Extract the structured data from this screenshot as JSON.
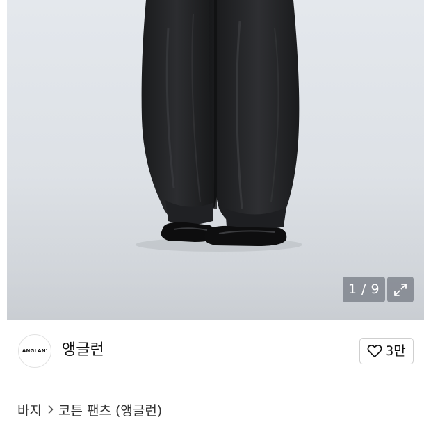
{
  "gallery": {
    "counter": "1 / 9",
    "expand_icon": "expand-icon"
  },
  "brand": {
    "logo_text": "ANGLAN'",
    "name": "앵글런",
    "like_count": "3만",
    "like_icon": "heart-outline-icon"
  },
  "breadcrumb": {
    "category": "바지",
    "separator_icon": "chevron-right-icon",
    "subcategory": "코튼 팬츠 (앵글런)"
  },
  "colors": {
    "background": "#ffffff",
    "photo_backdrop": "#dde1e6",
    "overlay": "#787e86",
    "text": "#111111",
    "border": "#cfcfcf"
  }
}
